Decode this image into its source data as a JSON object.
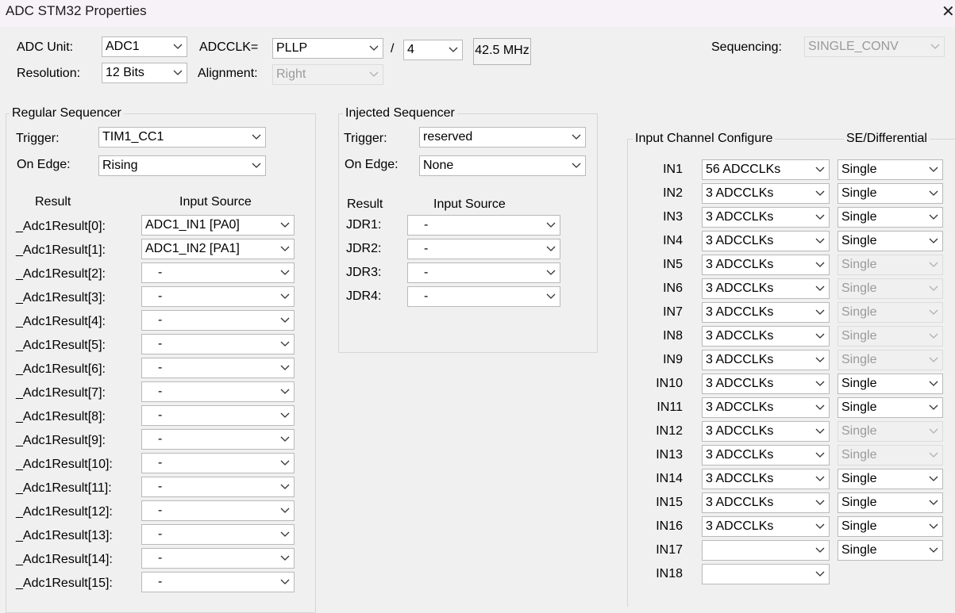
{
  "window": {
    "title": "ADC STM32 Properties",
    "close_glyph": "✕"
  },
  "top": {
    "adc_unit_label": "ADC Unit:",
    "adc_unit_value": "ADC1",
    "adcclk_label": "ADCCLK=",
    "adcclk_value": "PLLP",
    "divider_label": "/",
    "divider_value": "4",
    "freq_button": "42.5 MHz",
    "sequencing_label": "Sequencing:",
    "sequencing_value": "SINGLE_CONV",
    "resolution_label": "Resolution:",
    "resolution_value": "12 Bits",
    "alignment_label": "Alignment:",
    "alignment_value": "Right"
  },
  "regular": {
    "title": "Regular Sequencer",
    "trigger_label": "Trigger:",
    "trigger_value": "TIM1_CC1",
    "edge_label": "On Edge:",
    "edge_value": "Rising",
    "result_header": "Result",
    "source_header": "Input Source",
    "rows": [
      {
        "label": "_Adc1Result[0]:",
        "source": "ADC1_IN1 [PA0]"
      },
      {
        "label": "_Adc1Result[1]:",
        "source": "ADC1_IN2 [PA1]"
      },
      {
        "label": "_Adc1Result[2]:",
        "source": "-"
      },
      {
        "label": "_Adc1Result[3]:",
        "source": "-"
      },
      {
        "label": "_Adc1Result[4]:",
        "source": "-"
      },
      {
        "label": "_Adc1Result[5]:",
        "source": "-"
      },
      {
        "label": "_Adc1Result[6]:",
        "source": "-"
      },
      {
        "label": "_Adc1Result[7]:",
        "source": "-"
      },
      {
        "label": "_Adc1Result[8]:",
        "source": "-"
      },
      {
        "label": "_Adc1Result[9]:",
        "source": "-"
      },
      {
        "label": "_Adc1Result[10]:",
        "source": "-"
      },
      {
        "label": "_Adc1Result[11]:",
        "source": "-"
      },
      {
        "label": "_Adc1Result[12]:",
        "source": "-"
      },
      {
        "label": "_Adc1Result[13]:",
        "source": "-"
      },
      {
        "label": "_Adc1Result[14]:",
        "source": "-"
      },
      {
        "label": "_Adc1Result[15]:",
        "source": "-"
      }
    ]
  },
  "injected": {
    "title": "Injected Sequencer",
    "trigger_label": "Trigger:",
    "trigger_value": "reserved",
    "edge_label": "On Edge:",
    "edge_value": "None",
    "result_header": "Result",
    "source_header": "Input Source",
    "rows": [
      {
        "label": "JDR1:",
        "source": "-"
      },
      {
        "label": "JDR2:",
        "source": "-"
      },
      {
        "label": "JDR3:",
        "source": "-"
      },
      {
        "label": "JDR4:",
        "source": "-"
      }
    ]
  },
  "channels": {
    "title": "Input Channel Configure",
    "mode_header": "SE/Differential",
    "rows": [
      {
        "label": "IN1",
        "sample": "56 ADCCLKs",
        "mode": "Single",
        "mode_enabled": true
      },
      {
        "label": "IN2",
        "sample": "3 ADCCLKs",
        "mode": "Single",
        "mode_enabled": true
      },
      {
        "label": "IN3",
        "sample": "3 ADCCLKs",
        "mode": "Single",
        "mode_enabled": true
      },
      {
        "label": "IN4",
        "sample": "3 ADCCLKs",
        "mode": "Single",
        "mode_enabled": true
      },
      {
        "label": "IN5",
        "sample": "3 ADCCLKs",
        "mode": "Single",
        "mode_enabled": false
      },
      {
        "label": "IN6",
        "sample": "3 ADCCLKs",
        "mode": "Single",
        "mode_enabled": false
      },
      {
        "label": "IN7",
        "sample": "3 ADCCLKs",
        "mode": "Single",
        "mode_enabled": false
      },
      {
        "label": "IN8",
        "sample": "3 ADCCLKs",
        "mode": "Single",
        "mode_enabled": false
      },
      {
        "label": "IN9",
        "sample": "3 ADCCLKs",
        "mode": "Single",
        "mode_enabled": false
      },
      {
        "label": "IN10",
        "sample": "3 ADCCLKs",
        "mode": "Single",
        "mode_enabled": true
      },
      {
        "label": "IN11",
        "sample": "3 ADCCLKs",
        "mode": "Single",
        "mode_enabled": true
      },
      {
        "label": "IN12",
        "sample": "3 ADCCLKs",
        "mode": "Single",
        "mode_enabled": false
      },
      {
        "label": "IN13",
        "sample": "3 ADCCLKs",
        "mode": "Single",
        "mode_enabled": false
      },
      {
        "label": "IN14",
        "sample": "3 ADCCLKs",
        "mode": "Single",
        "mode_enabled": true
      },
      {
        "label": "IN15",
        "sample": "3 ADCCLKs",
        "mode": "Single",
        "mode_enabled": true
      },
      {
        "label": "IN16",
        "sample": "3 ADCCLKs",
        "mode": "Single",
        "mode_enabled": true
      },
      {
        "label": "IN17",
        "sample": "",
        "mode": "Single",
        "mode_enabled": true
      },
      {
        "label": "IN18",
        "sample": "",
        "mode": null,
        "mode_enabled": true
      }
    ]
  }
}
